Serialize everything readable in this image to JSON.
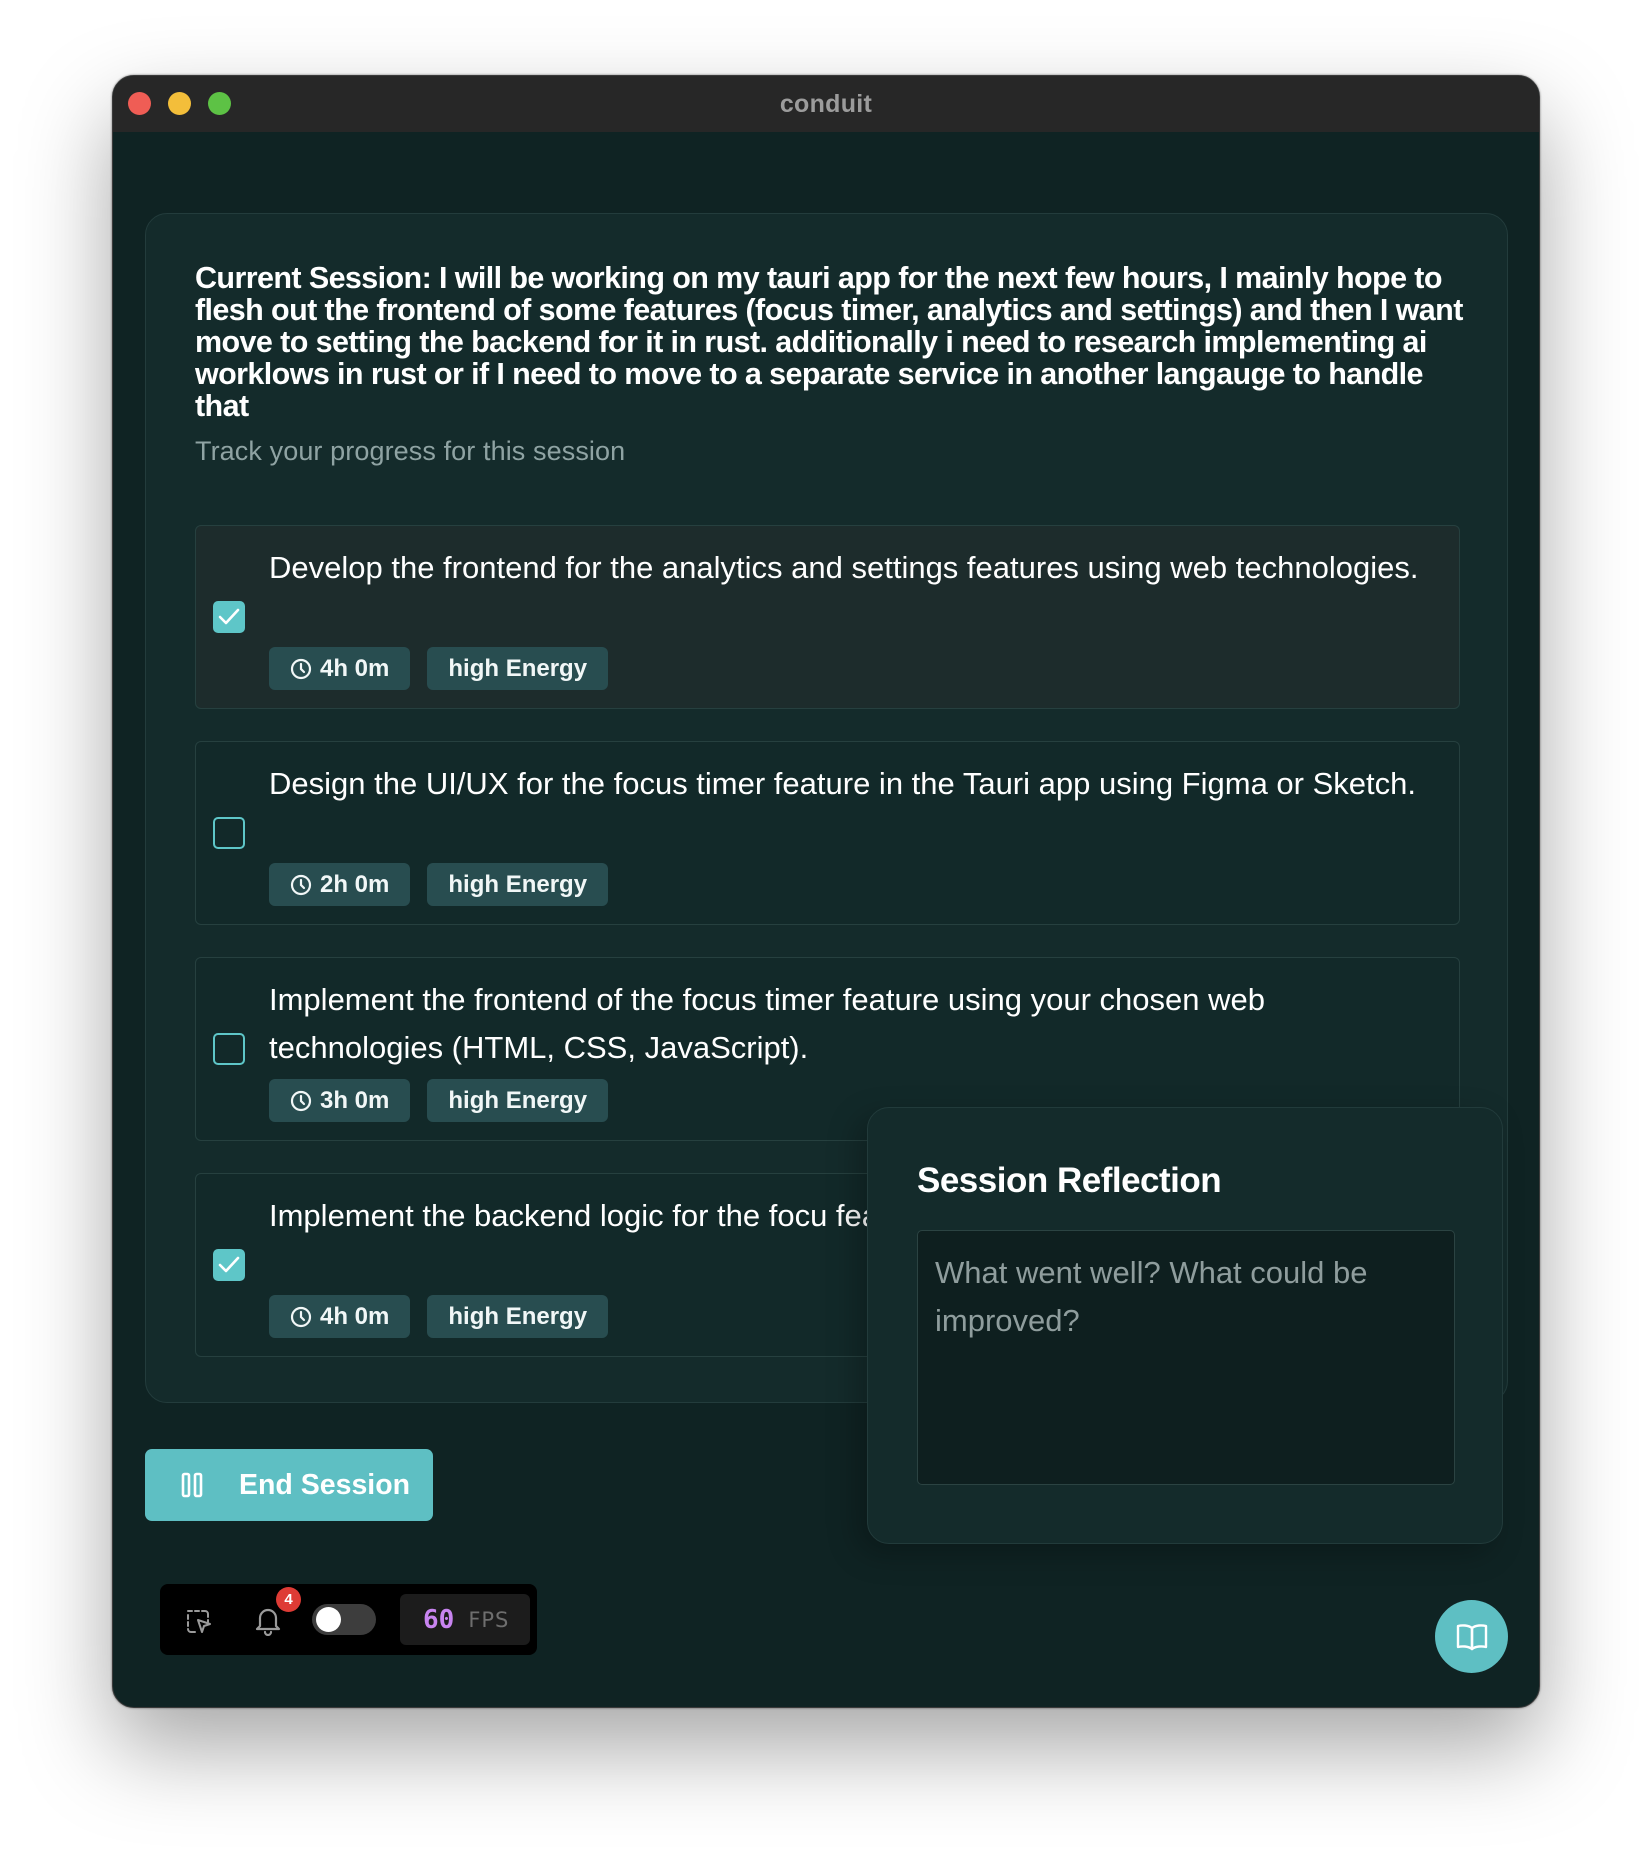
{
  "window": {
    "title": "conduit"
  },
  "session": {
    "title": "Current Session: I will be working on my tauri app for the next few hours, I mainly hope to flesh out the frontend of some features (focus timer, analytics and settings) and then I want move to setting the backend for it in rust. additionally i need to research implementing ai worklows in rust or if I need to move to a separate service in another langauge to handle that",
    "subtitle": "Track your progress for this session"
  },
  "tasks": [
    {
      "text": "Develop the frontend for the analytics and settings features using web technologies.",
      "checked": true,
      "duration": "4h 0m",
      "energy": "high Energy"
    },
    {
      "text": "Design the UI/UX for the focus timer feature in the Tauri app using Figma or Sketch.",
      "checked": false,
      "duration": "2h 0m",
      "energy": "high Energy"
    },
    {
      "text": "Implement the frontend of the focus timer feature using your chosen web technologies (HTML, CSS, JavaScript).",
      "checked": false,
      "duration": "3h 0m",
      "energy": "high Energy"
    },
    {
      "text": "Implement the backend logic for the focu features in Rust.",
      "checked": true,
      "duration": "4h 0m",
      "energy": "high Energy"
    }
  ],
  "reflection": {
    "title": "Session Reflection",
    "placeholder": "What went well? What could be improved?"
  },
  "actions": {
    "end_session_label": "End Session",
    "end_session_icon": "pause-icon"
  },
  "devbar": {
    "select_icon": "select-cursor-icon",
    "bell_icon": "bell-icon",
    "notification_count": "4",
    "toggle_on": false,
    "fps_value": "60",
    "fps_label": "FPS"
  },
  "docs_button": {
    "icon": "book-icon"
  },
  "colors": {
    "accent": "#5ebfc3",
    "background": "#0f2323",
    "card": "#142b2b",
    "tag": "#284d50",
    "badge": "#de3b35",
    "fps": "#c884f0"
  }
}
